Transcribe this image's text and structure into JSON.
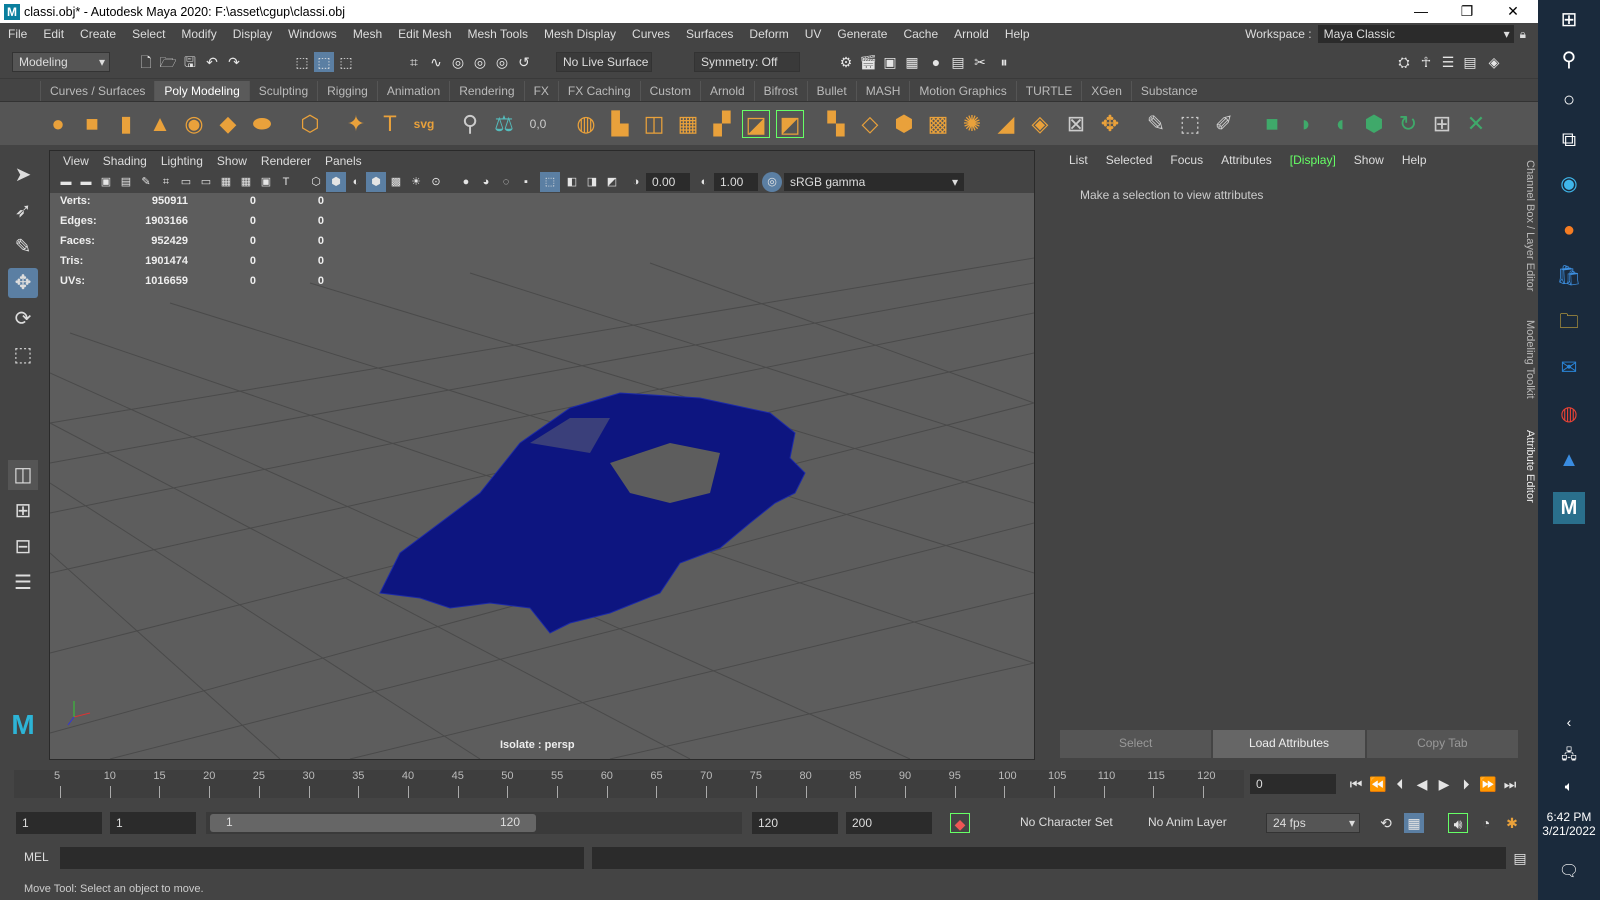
{
  "window": {
    "title": "classi.obj* - Autodesk Maya 2020: F:\\asset\\cgup\\classi.obj",
    "logo": "M"
  },
  "menu": [
    "File",
    "Edit",
    "Create",
    "Select",
    "Modify",
    "Display",
    "Windows",
    "Mesh",
    "Edit Mesh",
    "Mesh Tools",
    "Mesh Display",
    "Curves",
    "Surfaces",
    "Deform",
    "UV",
    "Generate",
    "Cache",
    "Arnold",
    "Help"
  ],
  "workspace": {
    "label": "Workspace :",
    "value": "Maya Classic"
  },
  "statusline": {
    "mode": "Modeling",
    "live_surface": "No Live Surface",
    "symmetry": "Symmetry: Off"
  },
  "shelf_tabs": [
    "Curves / Surfaces",
    "Poly Modeling",
    "Sculpting",
    "Rigging",
    "Animation",
    "Rendering",
    "FX",
    "FX Caching",
    "Custom",
    "Arnold",
    "Bifrost",
    "Bullet",
    "MASH",
    "Motion Graphics",
    "TURTLE",
    "XGen",
    "Substance"
  ],
  "shelf_active": "Poly Modeling",
  "panel_menu": [
    "View",
    "Shading",
    "Lighting",
    "Show",
    "Renderer",
    "Panels"
  ],
  "panel_toolbar": {
    "exposure": "0.00",
    "gamma": "1.00",
    "color_space": "sRGB gamma"
  },
  "hud": [
    {
      "label": "Verts:",
      "value": "950911",
      "a": "0",
      "b": "0"
    },
    {
      "label": "Edges:",
      "value": "1903166",
      "a": "0",
      "b": "0"
    },
    {
      "label": "Faces:",
      "value": "952429",
      "a": "0",
      "b": "0"
    },
    {
      "label": "Tris:",
      "value": "1901474",
      "a": "0",
      "b": "0"
    },
    {
      "label": "UVs:",
      "value": "1016659",
      "a": "0",
      "b": "0"
    }
  ],
  "isolate": "Isolate : persp",
  "attr_menu": [
    "List",
    "Selected",
    "Focus",
    "Attributes",
    "[Display]",
    "Show",
    "Help"
  ],
  "attr_message": "Make a selection to view attributes",
  "attr_buttons": [
    "Select",
    "Load Attributes",
    "Copy Tab"
  ],
  "side_tabs": [
    "Channel Box / Layer Editor",
    "Modeling Toolkit",
    "Attribute Editor"
  ],
  "timeline": {
    "ticks": [
      "5",
      "10",
      "15",
      "20",
      "25",
      "30",
      "35",
      "40",
      "45",
      "50",
      "55",
      "60",
      "65",
      "70",
      "75",
      "80",
      "85",
      "90",
      "95",
      "100",
      "105",
      "110",
      "115",
      "120"
    ],
    "current": "0"
  },
  "range": {
    "start": "1",
    "start2": "1",
    "slider_start": "1",
    "slider_end": "120",
    "end": "120",
    "end2": "200",
    "character_set": "No Character Set",
    "anim_layer": "No Anim Layer",
    "fps": "24 fps"
  },
  "cmd": {
    "label": "MEL"
  },
  "help_line": "Move Tool: Select an object to move.",
  "clock": {
    "time": "6:42 PM",
    "date": "3/21/2022"
  },
  "colors": {
    "mesh": "#0d1580",
    "bg": "#444444",
    "viewport": "#5d5d5d"
  }
}
